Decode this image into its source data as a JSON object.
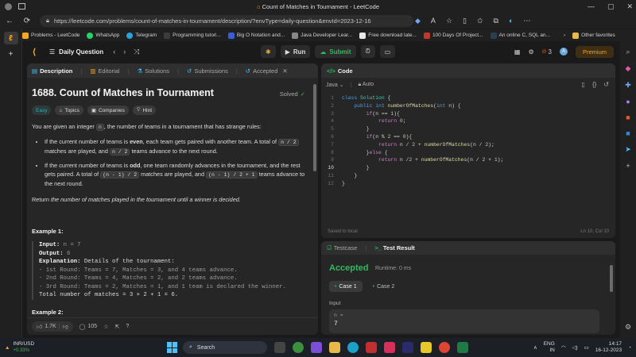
{
  "browser": {
    "window_title": "Count of Matches in Tournament - LeetCode",
    "url": "https://leetcode.com/problems/count-of-matches-in-tournament/description/?envType=daily-question&envId=2023-12-16",
    "bookmarks": [
      {
        "label": "Problems - LeetCode",
        "color": "#f5a623"
      },
      {
        "label": "WhatsApp",
        "color": "#25d366"
      },
      {
        "label": "Telegram",
        "color": "#2aa1da"
      },
      {
        "label": "Programming tutori...",
        "color": "#3c3c3c"
      },
      {
        "label": "Big O Notation and...",
        "color": "#3b5bdb"
      },
      {
        "label": "Java Developer Lear...",
        "color": "#888888"
      },
      {
        "label": "Free download late...",
        "color": "#e8e8e8"
      },
      {
        "label": "100 Days Of Project...",
        "color": "#c0392b"
      },
      {
        "label": "An online C, SQL an...",
        "color": "#2c3e50"
      }
    ],
    "other_favorites": "Other favorites"
  },
  "leetcode": {
    "daily_label": "Daily Question",
    "run_label": "Run",
    "submit_label": "Submit",
    "streak": "3",
    "avatar_letter": "A",
    "premium_label": "Premium"
  },
  "problem": {
    "tabs": [
      "Description",
      "Editorial",
      "Solutions",
      "Submissions",
      "Accepted"
    ],
    "title": "1688. Count of Matches in Tournament",
    "status": "Solved",
    "chips": [
      "Easy",
      "Topics",
      "Companies",
      "Hint"
    ],
    "intro_pre": "You are given an integer ",
    "intro_code": "n",
    "intro_post": ", the number of teams in a tournament that has strange rules:",
    "bullet1": {
      "a": "If the current number of teams is ",
      "bold": "even",
      "b": ", each team gets paired with another team. A total of ",
      "code1": "n / 2",
      "c": " matches are played, and ",
      "code2": "n / 2",
      "d": " teams advance to the next round."
    },
    "bullet2": {
      "a": "If the current number of teams is ",
      "bold": "odd",
      "b": ", one team randomly advances in the tournament, and the rest gets paired. A total of ",
      "code1": "(n - 1) / 2",
      "c": " matches are played, and ",
      "code2": "(n - 1) / 2 + 1",
      "d": " teams advance to the next round."
    },
    "return_pre": "Return ",
    "return_ital": "the number of matches played in the tournament until a winner is decided.",
    "example1": {
      "heading": "Example 1:",
      "input_label": "Input:",
      "input_value": " n = 7",
      "output_label": "Output:",
      "output_value": " 6",
      "explanation_label": "Explanation:",
      "explanation_value": " Details of the tournament:",
      "lines": [
        "- 1st Round: Teams = 7, Matches = 3, and 4 teams advance.",
        "- 2nd Round: Teams = 4, Matches = 2, and 2 teams advance.",
        "- 3rd Round: Teams = 2, Matches = 1, and 1 team is declared the winner."
      ],
      "total": "Total number of matches = 3 + 2 + 1 = 6."
    },
    "example2_heading": "Example 2:",
    "likes": "1.7K",
    "comments": "105"
  },
  "editor": {
    "title": "Code",
    "language": "Java",
    "mode": "Auto",
    "lines": [
      "class Solution {",
      "    public int numberOfMatches(int n) {",
      "        if(n == 1){",
      "            return 0;",
      "        }",
      "        if(n % 2 == 0){",
      "            return n / 2 + numberOfMatches(n / 2);",
      "        }else {",
      "            return n /2 + numberOfMatches(n / 2 + 1);",
      "        }",
      "    }",
      "}"
    ],
    "current_line": 10,
    "saved": "Saved to local",
    "cursor": "Ln 10, Col 10"
  },
  "test": {
    "tab_testcase": "Testcase",
    "tab_result": "Test Result",
    "verdict": "Accepted",
    "runtime": "Runtime: 0 ms",
    "cases": [
      "Case 1",
      "Case 2"
    ],
    "input_label": "Input",
    "var_name": "n =",
    "var_value": "7"
  },
  "taskbar": {
    "stock_name": "INR/USD",
    "stock_change": "+0.33%",
    "search": "Search",
    "lang1": "ENG",
    "lang2": "IN",
    "time": "14:17",
    "date": "16-12-2023"
  }
}
